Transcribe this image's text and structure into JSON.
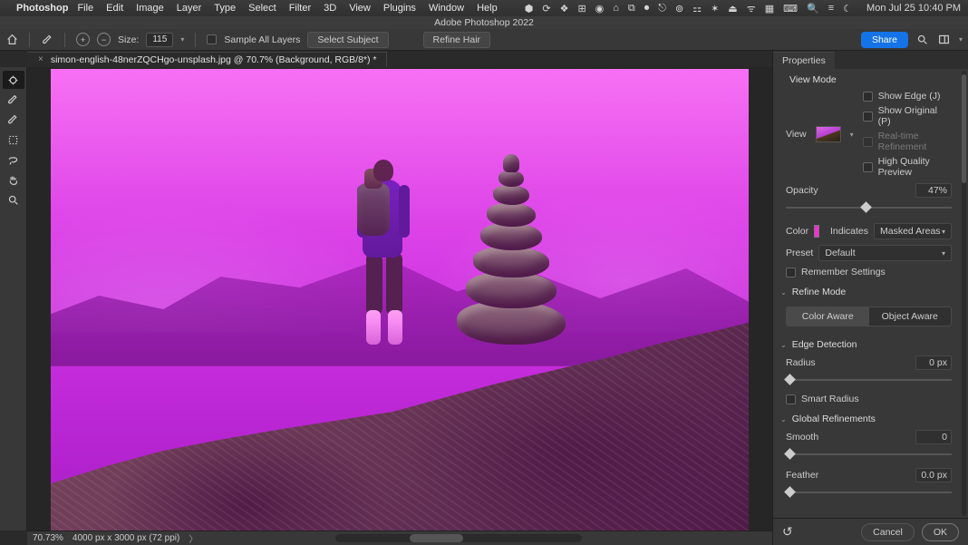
{
  "menubar": {
    "apple": "",
    "app_name": "Photoshop",
    "menus": [
      "File",
      "Edit",
      "Image",
      "Layer",
      "Type",
      "Select",
      "Filter",
      "3D",
      "View",
      "Plugins",
      "Window",
      "Help"
    ],
    "status_icons": [
      "⬢",
      "⟳",
      "❖",
      "⊞",
      "◉",
      "⌂",
      "⧉",
      "⏺",
      "⎋",
      "⊚",
      "⚏",
      "✶",
      "⏏",
      "ᯤ",
      "▦",
      "⌨",
      "🔍",
      "≡",
      "☾"
    ],
    "clock": "Mon Jul 25  10:40 PM"
  },
  "window": {
    "title": "Adobe Photoshop 2022"
  },
  "options": {
    "size_label": "Size:",
    "size_value": "115",
    "sample_all_layers": "Sample All Layers",
    "select_subject": "Select Subject",
    "refine_hair": "Refine Hair",
    "share": "Share"
  },
  "document": {
    "tab_title": "simon-english-48nerZQCHgo-unsplash.jpg @ 70.7% (Background, RGB/8*) *"
  },
  "statusbar": {
    "zoom": "70.73%",
    "dims": "4000 px x 3000 px (72 ppi)"
  },
  "props": {
    "panel_title": "Properties",
    "view_mode": {
      "title": "View Mode",
      "view_label": "View",
      "show_edge": "Show Edge (J)",
      "show_original": "Show Original (P)",
      "realtime": "Real-time Refinement",
      "hq_preview": "High Quality Preview"
    },
    "opacity": {
      "label": "Opacity",
      "value": "47%",
      "thumb_pct": 47
    },
    "color": {
      "label": "Color",
      "swatch": "#ff2bd6",
      "indicates_label": "Indicates",
      "indicates_value": "Masked Areas"
    },
    "preset": {
      "label": "Preset",
      "value": "Default"
    },
    "remember": "Remember Settings",
    "refine_mode": {
      "title": "Refine Mode",
      "color_aware": "Color Aware",
      "object_aware": "Object Aware"
    },
    "edge": {
      "title": "Edge Detection",
      "radius_label": "Radius",
      "radius_value": "0 px",
      "smart_radius": "Smart Radius"
    },
    "global": {
      "title": "Global Refinements",
      "smooth_label": "Smooth",
      "smooth_value": "0",
      "feather_label": "Feather",
      "feather_value": "0.0 px"
    },
    "footer": {
      "cancel": "Cancel",
      "ok": "OK"
    }
  }
}
